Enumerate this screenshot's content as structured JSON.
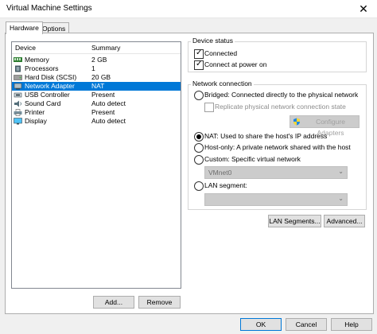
{
  "window": {
    "title": "Virtual Machine Settings",
    "close_glyph": "✕"
  },
  "tabs": [
    {
      "label": "Hardware"
    },
    {
      "label": "Options"
    }
  ],
  "device_list": {
    "col_device": "Device",
    "col_summary": "Summary",
    "rows": [
      {
        "name": "Memory",
        "summary": "2 GB",
        "icon": "memory-icon"
      },
      {
        "name": "Processors",
        "summary": "1",
        "icon": "processor-icon"
      },
      {
        "name": "Hard Disk (SCSI)",
        "summary": "20 GB",
        "icon": "hard-disk-icon"
      },
      {
        "name": "Network Adapter",
        "summary": "NAT",
        "icon": "network-adapter-icon",
        "selected": true
      },
      {
        "name": "USB Controller",
        "summary": "Present",
        "icon": "usb-icon"
      },
      {
        "name": "Sound Card",
        "summary": "Auto detect",
        "icon": "sound-card-icon"
      },
      {
        "name": "Printer",
        "summary": "Present",
        "icon": "printer-icon"
      },
      {
        "name": "Display",
        "summary": "Auto detect",
        "icon": "display-icon"
      }
    ]
  },
  "device_status": {
    "title": "Device status",
    "connected": {
      "label": "Connected",
      "checked": true
    },
    "connect_power_on": {
      "label": "Connect at power on",
      "checked": true
    }
  },
  "network_connection": {
    "title": "Network connection",
    "bridged": {
      "label": "Bridged: Connected directly to the physical network",
      "checked": false
    },
    "replicate": {
      "label": "Replicate physical network connection state",
      "checked": false
    },
    "configure_adapters": "Configure Adapters",
    "nat": {
      "label": "NAT: Used to share the host's IP address",
      "checked": true
    },
    "host_only": {
      "label": "Host-only: A private network shared with the host",
      "checked": false
    },
    "custom": {
      "label": "Custom: Specific virtual network",
      "checked": false
    },
    "custom_select_value": "VMnet0",
    "lan_segment": {
      "label": "LAN segment:",
      "checked": false
    },
    "lan_select_value": ""
  },
  "buttons": {
    "lan_segments": "LAN Segments...",
    "advanced": "Advanced...",
    "add": "Add...",
    "remove": "Remove",
    "ok": "OK",
    "cancel": "Cancel",
    "help": "Help"
  },
  "colors": {
    "selection": "#0078d7",
    "ok_border": "#0078d7"
  }
}
